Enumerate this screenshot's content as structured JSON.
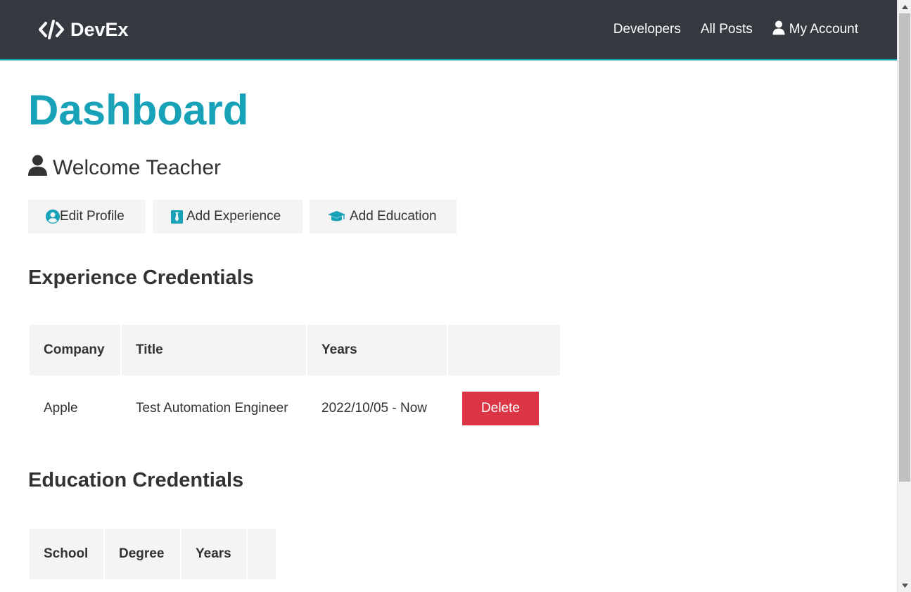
{
  "navbar": {
    "brand_text": "DevEx",
    "links": [
      {
        "label": "Developers"
      },
      {
        "label": "All Posts"
      },
      {
        "label": "My Account"
      }
    ]
  },
  "main": {
    "title": "Dashboard",
    "welcome": "Welcome Teacher",
    "actions": {
      "edit_profile": "Edit Profile",
      "add_experience": "Add Experience",
      "add_education": "Add Education"
    }
  },
  "experience": {
    "heading": "Experience Credentials",
    "columns": [
      "Company",
      "Title",
      "Years",
      ""
    ],
    "rows": [
      {
        "company": "Apple",
        "title": "Test Automation Engineer",
        "years": "2022/10/05 - Now",
        "action_label": "Delete"
      }
    ]
  },
  "education": {
    "heading": "Education Credentials",
    "columns": [
      "School",
      "Degree",
      "Years",
      ""
    ]
  },
  "colors": {
    "navbar_bg": "#343a40",
    "primary": "#17a2b8",
    "danger": "#dc3545",
    "light": "#f4f4f4",
    "text": "#333333"
  },
  "icons": {
    "brand": "code-icon",
    "account": "user-icon",
    "welcome": "user-icon",
    "edit_profile": "user-circle-icon",
    "add_experience": "black-tie-icon",
    "add_education": "graduation-cap-icon"
  }
}
